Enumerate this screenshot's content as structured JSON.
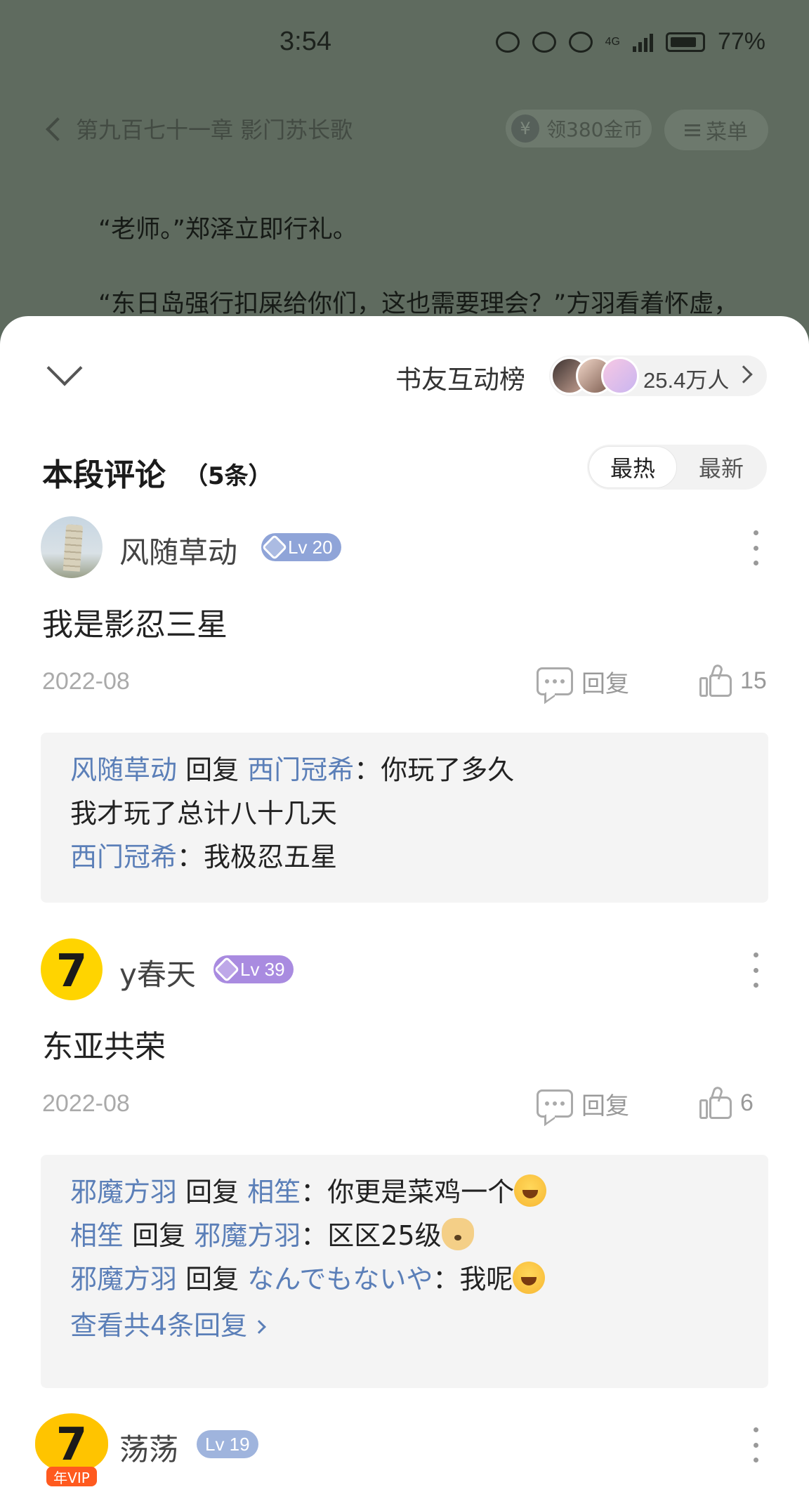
{
  "status_bar": {
    "time": "3:54",
    "battery": "77%",
    "network": "4G"
  },
  "reader": {
    "chapter_title": "第九百七十一章 影门苏长歌",
    "coin_button": "领380金币",
    "coin_icon": "¥",
    "menu_button": "菜单",
    "paragraphs": [
      "“老师。”郑泽立即行礼。",
      "“东日岛强行扣屎给你们，这也需要理会？”方羽看着怀虚，"
    ]
  },
  "sheet": {
    "rank_title": "书友互动榜",
    "rank_count": "25.4万人",
    "section_title": "本段评论",
    "section_count": "（5条）",
    "sort_hot": "最热",
    "sort_new": "最新",
    "reply_label": "回复",
    "colors": {
      "link": "#5b7fb8",
      "lv_low": "#8fa4d8",
      "lv_mid": "#a98be0",
      "lv_vip": "#9fb4dd"
    }
  },
  "comments": [
    {
      "username": "风随草动",
      "level": "Lv 20",
      "text": "我是影忍三星",
      "date": "2022-08",
      "likes": "15",
      "avatar_icon": "leaning-tower-avatar",
      "replies": [
        {
          "from": "风随草动",
          "verb": "回复",
          "to": "西门冠希",
          "sep": "：",
          "text": "你玩了多久"
        },
        {
          "plain": "我才玩了总计八十几天"
        },
        {
          "from": "西门冠希",
          "sep": "：",
          "text": "我极忍五星"
        }
      ]
    },
    {
      "username": "y春天",
      "level": "Lv 39",
      "text": "东亚共荣",
      "date": "2022-08",
      "likes": "6",
      "avatar_icon": "black-cat-seven-avatar",
      "replies": [
        {
          "from": "邪魔方羽",
          "verb": "回复",
          "to": "相笙",
          "sep": "：",
          "text": "你更是菜鸡一个",
          "emoji": "laugh-cry-emoji"
        },
        {
          "from": "相笙",
          "verb": "回复",
          "to": "邪魔方羽",
          "sep": "：",
          "text": "区区25级",
          "emoji": "doge-emoji"
        },
        {
          "from": "邪魔方羽",
          "verb": "回复",
          "to": "なんでもないや",
          "sep": "：",
          "text": "我呢",
          "emoji": "laugh-cry-emoji"
        }
      ],
      "more_replies": "查看共4条回复"
    },
    {
      "username": "荡荡",
      "level": "Lv 19",
      "vip_badge": "年VIP",
      "avatar_icon": "vip-cat-avatar"
    }
  ]
}
